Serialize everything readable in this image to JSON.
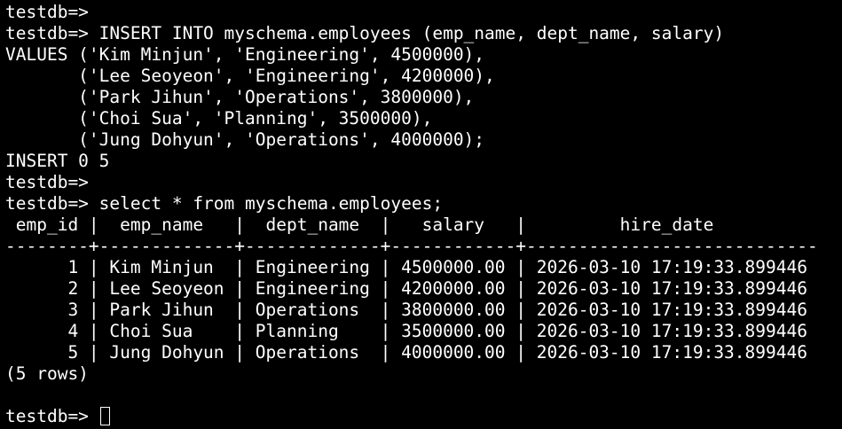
{
  "terminal": {
    "lines": [
      "testdb=>",
      "testdb=> INSERT INTO myschema.employees (emp_name, dept_name, salary)",
      "VALUES ('Kim Minjun', 'Engineering', 4500000),",
      "       ('Lee Seoyeon', 'Engineering', 4200000),",
      "       ('Park Jihun', 'Operations', 3800000),",
      "       ('Choi Sua', 'Planning', 3500000),",
      "       ('Jung Dohyun', 'Operations', 4000000);",
      "INSERT 0 5",
      "testdb=>",
      "testdb=> select * from myschema.employees;",
      " emp_id |  emp_name   |  dept_name  |   salary   |         hire_date",
      "--------+-------------+-------------+------------+----------------------------",
      "      1 | Kim Minjun  | Engineering | 4500000.00 | 2026-03-10 17:19:33.899446",
      "      2 | Lee Seoyeon | Engineering | 4200000.00 | 2026-03-10 17:19:33.899446",
      "      3 | Park Jihun  | Operations  | 3800000.00 | 2026-03-10 17:19:33.899446",
      "      4 | Choi Sua    | Planning    | 3500000.00 | 2026-03-10 17:19:33.899446",
      "      5 | Jung Dohyun | Operations  | 4000000.00 | 2026-03-10 17:19:33.899446",
      "(5 rows)",
      ""
    ],
    "prompt": "testdb=> "
  },
  "colors": {
    "background": "#000000",
    "foreground": "#ffffff"
  }
}
